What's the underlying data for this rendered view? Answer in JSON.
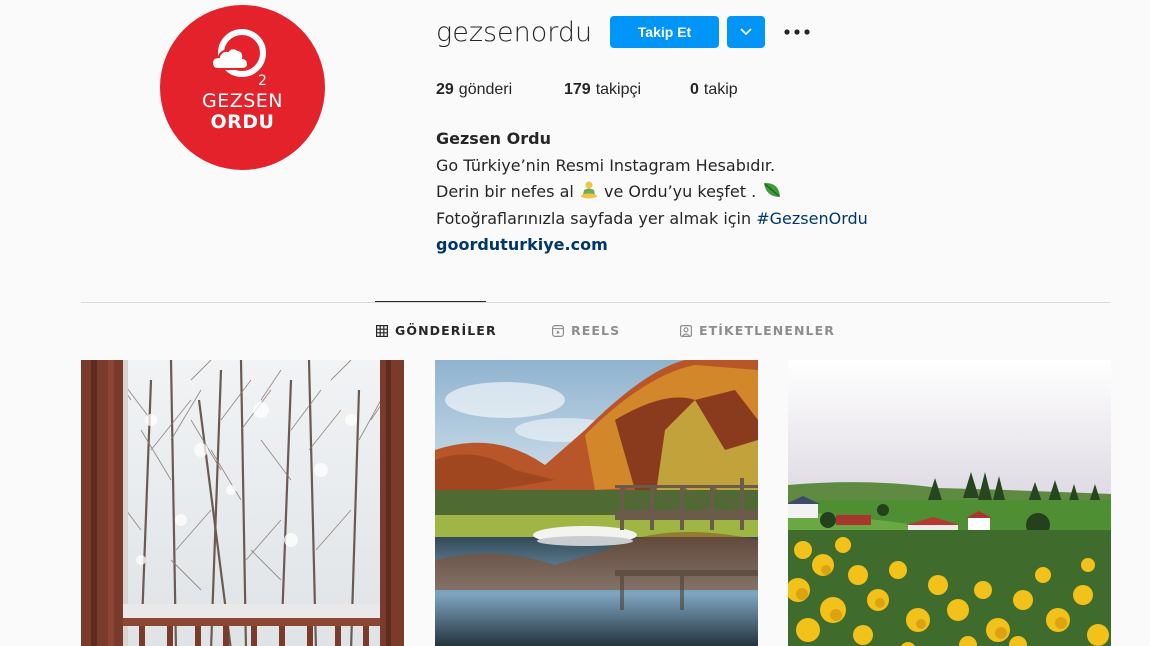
{
  "profile": {
    "avatar_text_line1": "GEZSEN",
    "avatar_text_line2": "ORDU",
    "username": "gezsenordu",
    "follow_label": "Takip Et"
  },
  "stats": {
    "posts_count": "29",
    "posts_label": "gönderi",
    "followers_count": "179",
    "followers_label": "takipçi",
    "following_count": "0",
    "following_label": "takip"
  },
  "bio": {
    "full_name": "Gezsen Ordu",
    "line1": "Go Türkiye’nin Resmi Instagram Hesabıdır.",
    "line2_a": "Derin bir nefes al",
    "line2_b": "ve Ordu’yu keşfet .",
    "line3_text": "Fotoğraflarınızla sayfada yer almak için",
    "line3_hashtag": "#GezsenOrdu",
    "website": "goorduturkiye.com"
  },
  "tabs": [
    {
      "label": "GÖNDERİLER",
      "icon": "grid-icon",
      "active": true
    },
    {
      "label": "REELS",
      "icon": "reels-icon",
      "active": false
    },
    {
      "label": "ETİKETLENENLER",
      "icon": "tagged-icon",
      "active": false
    }
  ],
  "posts": [
    {
      "subject": "snowy forest seen from wooden balcony"
    },
    {
      "subject": "autumn lake with wooden pier and boat"
    },
    {
      "subject": "yellow flowers in green highland village"
    }
  ],
  "colors": {
    "accent": "#0095f6",
    "brand_red": "#e4222b",
    "link": "#00376b"
  }
}
